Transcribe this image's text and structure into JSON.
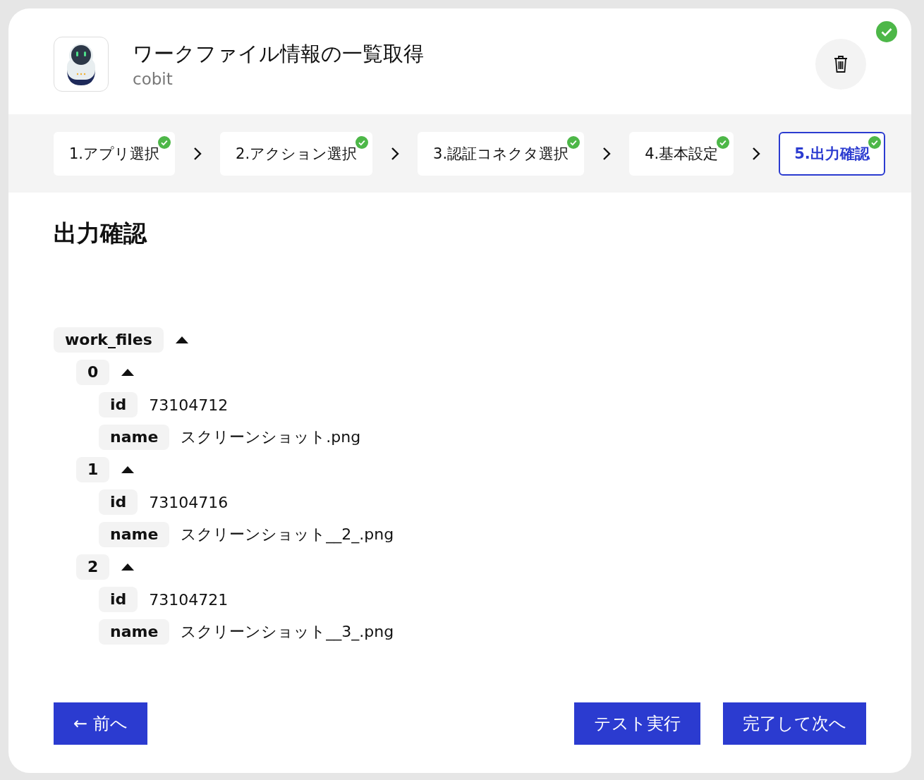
{
  "header": {
    "title": "ワークファイル情報の一覧取得",
    "subtitle": "cobit",
    "completed": true
  },
  "steps": [
    {
      "label": "1.アプリ選択",
      "done": true,
      "selected": false
    },
    {
      "label": "2.アクション選択",
      "done": true,
      "selected": false
    },
    {
      "label": "3.認証コネクタ選択",
      "done": true,
      "selected": false
    },
    {
      "label": "4.基本設定",
      "done": true,
      "selected": false
    },
    {
      "label": "5.出力確認",
      "done": true,
      "selected": true
    }
  ],
  "section_title": "出力確認",
  "output_tree": [
    {
      "key": "work_files",
      "expanded": true,
      "children": [
        {
          "key": "0",
          "expanded": true,
          "children": [
            {
              "key": "id",
              "value": "73104712"
            },
            {
              "key": "name",
              "value": "スクリーンショット.png"
            }
          ]
        },
        {
          "key": "1",
          "expanded": true,
          "children": [
            {
              "key": "id",
              "value": "73104716"
            },
            {
              "key": "name",
              "value": "スクリーンショット__2_.png"
            }
          ]
        },
        {
          "key": "2",
          "expanded": true,
          "children": [
            {
              "key": "id",
              "value": "73104721"
            },
            {
              "key": "name",
              "value": "スクリーンショット__3_.png"
            }
          ]
        }
      ]
    }
  ],
  "buttons": {
    "back": "← 前へ",
    "test": "テスト実行",
    "next": "完了して次へ"
  }
}
